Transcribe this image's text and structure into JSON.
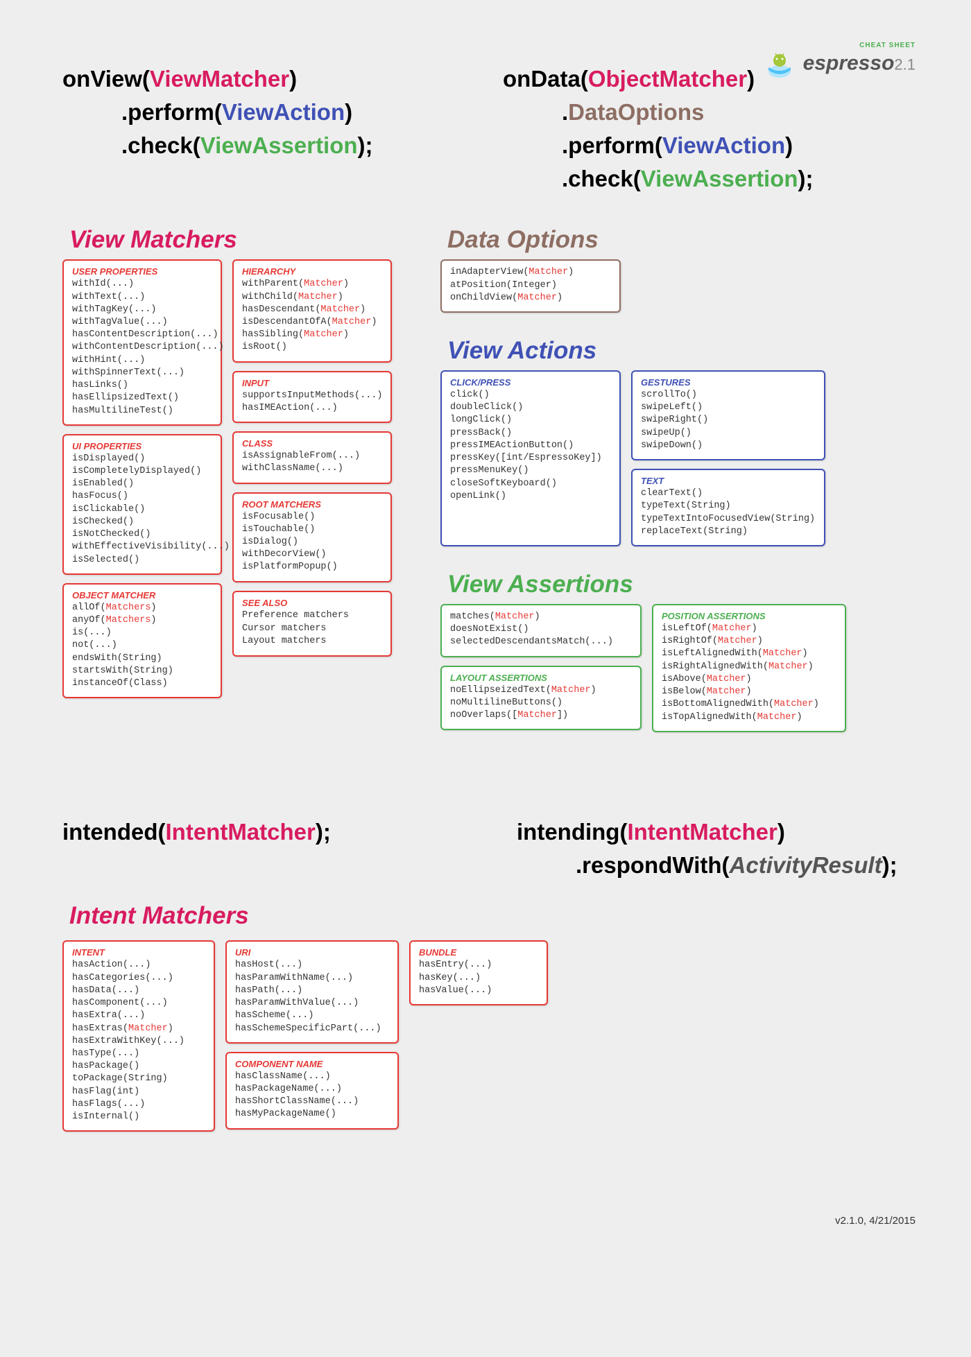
{
  "header": {
    "cheat_sheet": "CHEAT SHEET",
    "espresso": "espresso",
    "version": "2.1"
  },
  "sig": {
    "onview": {
      "fn": "onView",
      "arg": "ViewMatcher",
      "p1": ".perform(",
      "p1a": "ViewAction",
      "p1e": ")",
      "p2": ".check(",
      "p2a": "ViewAssertion",
      "p2e": ");"
    },
    "ondata": {
      "fn": "onData",
      "arg": "ObjectMatcher",
      "d1": ".",
      "d1a": "DataOptions",
      "p1": ".perform(",
      "p1a": "ViewAction",
      "p1e": ")",
      "p2": ".check(",
      "p2a": "ViewAssertion",
      "p2e": ");"
    }
  },
  "sections": {
    "view_matchers": "View Matchers",
    "data_options": "Data Options",
    "view_actions": "View Actions",
    "view_assertions": "View Assertions",
    "intent_matchers": "Intent Matchers"
  },
  "cards": {
    "user_props": {
      "title": "USER PROPERTIES",
      "lines": [
        "withId(...)",
        "withText(...)",
        "withTagKey(...)",
        "withTagValue(...)",
        "hasContentDescription(...)",
        "withContentDescription(...)",
        "withHint(...)",
        "withSpinnerText(...)",
        "hasLinks()",
        "hasEllipsizedText()",
        "hasMultilineTest()"
      ]
    },
    "ui_props": {
      "title": "UI PROPERTIES",
      "lines": [
        "isDisplayed()",
        "isCompletelyDisplayed()",
        "isEnabled()",
        "hasFocus()",
        "isClickable()",
        "isChecked()",
        "isNotChecked()",
        "withEffectiveVisibility(...)",
        "isSelected()"
      ]
    },
    "obj_matcher": {
      "title": "OBJECT MATCHER",
      "html": "allOf(<span class='m'>Matchers</span>)<br>anyOf(<span class='m'>Matchers</span>)<br>is(...)<br>not(...)<br>endsWith(String)<br>startsWith(String)<br>instanceOf(Class)"
    },
    "hierarchy": {
      "title": "HIERARCHY",
      "html": "withParent(<span class='m'>Matcher</span>)<br>withChild(<span class='m'>Matcher</span>)<br>hasDescendant(<span class='m'>Matcher</span>)<br>isDescendantOfA(<span class='m'>Matcher</span>)<br>hasSibling(<span class='m'>Matcher</span>)<br>isRoot()"
    },
    "input": {
      "title": "INPUT",
      "lines": [
        "supportsInputMethods(...)",
        "hasIMEAction(...)"
      ]
    },
    "klass": {
      "title": "CLASS",
      "lines": [
        "isAssignableFrom(...)",
        "withClassName(...)"
      ]
    },
    "root": {
      "title": "ROOT MATCHERS",
      "lines": [
        "isFocusable()",
        "isTouchable()",
        "isDialog()",
        "withDecorView()",
        "isPlatformPopup()"
      ]
    },
    "seealso": {
      "title": "SEE ALSO",
      "lines": [
        "Preference matchers",
        "Cursor matchers",
        "Layout matchers"
      ]
    },
    "data_opts": {
      "html": "inAdapterView(<span class='m'>Matcher</span>)<br>atPosition(Integer)<br>onChildView(<span class='m'>Matcher</span>)"
    },
    "click": {
      "title": "CLICK/PRESS",
      "lines": [
        "click()",
        "doubleClick()",
        "longClick()",
        "pressBack()",
        "pressIMEActionButton()",
        "pressKey([int/EspressoKey])",
        "pressMenuKey()",
        "closeSoftKeyboard()",
        "openLink()"
      ]
    },
    "gestures": {
      "title": "GESTURES",
      "lines": [
        "scrollTo()",
        "swipeLeft()",
        "swipeRight()",
        "swipeUp()",
        "swipeDown()"
      ]
    },
    "text": {
      "title": "TEXT",
      "lines": [
        "clearText()",
        "typeText(String)",
        "typeTextIntoFocusedView(String)",
        "replaceText(String)"
      ]
    },
    "assert_main": {
      "html": "matches(<span class='m'>Matcher</span>)<br>doesNotExist()<br>selectedDescendantsMatch(...)"
    },
    "layout_assert": {
      "title": "LAYOUT ASSERTIONS",
      "html": "noEllipseizedText(<span class='m'>Matcher</span>)<br>noMultilineButtons()<br>noOverlaps([<span class='m'>Matcher</span>])"
    },
    "pos_assert": {
      "title": "POSITION ASSERTIONS",
      "html": "isLeftOf(<span class='m'>Matcher</span>)<br>isRightOf(<span class='m'>Matcher</span>)<br>isLeftAlignedWith(<span class='m'>Matcher</span>)<br>isRightAlignedWith(<span class='m'>Matcher</span>)<br>isAbove(<span class='m'>Matcher</span>)<br>isBelow(<span class='m'>Matcher</span>)<br>isBottomAlignedWith(<span class='m'>Matcher</span>)<br>isTopAlignedWith(<span class='m'>Matcher</span>)"
    },
    "intent": {
      "title": "INTENT",
      "html": "hasAction(...)<br>hasCategories(...)<br>hasData(...)<br>hasComponent(...)<br>hasExtra(...)<br>hasExtras(<span class='m'>Matcher</span>)<br>hasExtraWithKey(...)<br>hasType(...)<br>hasPackage()<br>toPackage(String)<br>hasFlag(int)<br>hasFlags(...)<br>isInternal()"
    },
    "uri": {
      "title": "URI",
      "lines": [
        "hasHost(...)",
        "hasParamWithName(...)",
        "hasPath(...)",
        "hasParamWithValue(...)",
        "hasScheme(...)",
        "hasSchemeSpecificPart(...)"
      ]
    },
    "compname": {
      "title": "COMPONENT NAME",
      "lines": [
        "hasClassName(...)",
        "hasPackageName(...)",
        "hasShortClassName(...)",
        "hasMyPackageName()"
      ]
    },
    "bundle": {
      "title": "BUNDLE",
      "lines": [
        "hasEntry(...)",
        "hasKey(...)",
        "hasValue(...)"
      ]
    }
  },
  "intent_sig": {
    "intended": {
      "fn": "intended",
      "arg": "IntentMatcher",
      "e": ");"
    },
    "intending": {
      "fn": "intending",
      "arg": "IntentMatcher",
      "e": ")",
      "r1": ".respondWith(",
      "r1a": "ActivityResult",
      "r1e": ");"
    }
  },
  "footer": "v2.1.0, 4/21/2015"
}
